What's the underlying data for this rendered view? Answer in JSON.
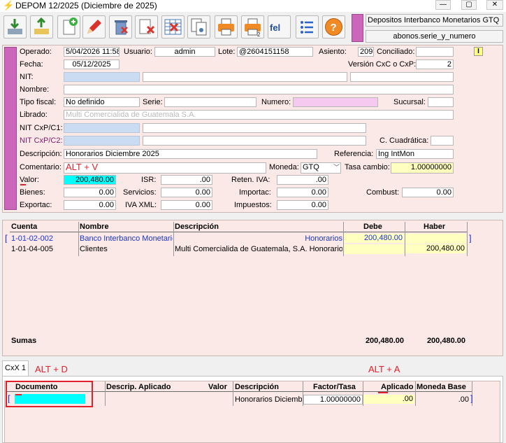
{
  "window": {
    "title": "DEPOM 12/2025 (Diciembre de 2025)",
    "min": "—",
    "max": "▢",
    "close": "✕"
  },
  "right_panel": {
    "doc_type": "Depositos Interbanco Monetarios GTQ",
    "series_field": "abonos.serie_y_numero"
  },
  "form": {
    "operado_label": "Operado:",
    "operado_value": "5/04/2026 11:58",
    "usuario_label": "Usuario:",
    "usuario_value": "admin",
    "lote_label": "Lote:",
    "lote_value": "@2604151158",
    "asiento_label": "Asiento:",
    "asiento_value": "209",
    "conciliado_label": "Conciliado:",
    "conciliado_value": "",
    "i_badge": "I",
    "fecha_label": "Fecha:",
    "fecha_value": "05/12/2025",
    "version_label": "Versión CxC o CxP:",
    "version_value": "2",
    "nit_label": "NIT:",
    "nombre_label": "Nombre:",
    "tipo_fiscal_label": "Tipo fiscal:",
    "tipo_fiscal_value": "No definido",
    "serie_label": "Serie:",
    "serie_value": "",
    "numero_label": "Numero:",
    "sucursal_label": "Sucursal:",
    "sucursal_value": "",
    "librado_label": "Librado:",
    "librado_value": "Multi Comercialida de Guatemala S.A.",
    "nit_cxp_c1_label": "NIT CxP/C1:",
    "nit_cxp_c2_label": "NIT CxP/C2:",
    "c_cuadratica_label": "C. Cuadrática:",
    "descripcion_label": "Descripción:",
    "descripcion_value": "Honorarios Diciembre 2025",
    "referencia_label": "Referencia:",
    "referencia_value": "Ing IntMon",
    "comentario_label": "Comentario:",
    "comentario_annotation": "ALT + V",
    "moneda_label": "Moneda:",
    "moneda_value": "GTQ",
    "tasa_label": "Tasa cambio:",
    "tasa_value": "1.00000000",
    "valor_label": "Valor:",
    "valor_value": "200,480.00",
    "isr_label": "ISR:",
    "isr_value": ".00",
    "reten_iva_label": "Reten. IVA:",
    "reten_iva_value": ".00",
    "bienes_label": "Bienes:",
    "bienes_value": "0.00",
    "servicios_label": "Servicios:",
    "servicios_value": "0.00",
    "importac_label": "Importac:",
    "importac_value": "0.00",
    "combust_label": "Combust:",
    "combust_value": "0.00",
    "exportac_label": "Exportac:",
    "exportac_value": "0.00",
    "iva_xml_label": "IVA XML:",
    "iva_xml_value": "0.00",
    "impuestos_label": "Impuestos:",
    "impuestos_value": "0.00"
  },
  "entries": {
    "columns": [
      "Cuenta",
      "Nombre",
      "Descripción",
      "Debe",
      "Haber"
    ],
    "rows": [
      {
        "bracket_left": "[",
        "cuenta": "1-01-02-002",
        "nombre": "Banco Interbanco Monetario",
        "descripcion": "Honorarios",
        "debe": "200,480.00",
        "haber": "",
        "bracket_right": "]"
      },
      {
        "bracket_left": "",
        "cuenta": "1-01-04-005",
        "nombre": "Clientes",
        "descripcion": "Multi Comercialida de Guatemala, S.A. Honorarios",
        "debe": "",
        "haber": "200,480.00",
        "bracket_right": ""
      }
    ],
    "sumas_label": "Sumas",
    "sumas_debe": "200,480.00",
    "sumas_haber": "200,480.00"
  },
  "bottom": {
    "tab_label": "CxX 1",
    "alt_d": "ALT + D",
    "alt_a": "ALT + A",
    "columns": [
      "Documento",
      "Descrip. Aplicado",
      "Valor",
      "Descripción",
      "Factor/Tasa",
      "Aplicado",
      "Moneda Base"
    ],
    "row": {
      "bracket_left": "[",
      "documento": "",
      "descripcion": "Honorarios Diciembre",
      "factor": "1.00000000",
      "aplicado": ".00",
      "moneda_base": ".00",
      "bracket_right": "]"
    }
  },
  "colors": {
    "accent_magenta": "#cc66bb",
    "header_bg": "#fbe9e7",
    "highlight_yellow": "#ffffc0",
    "highlight_cyan": "#00ffff",
    "annotation_red": "#e0202a"
  }
}
